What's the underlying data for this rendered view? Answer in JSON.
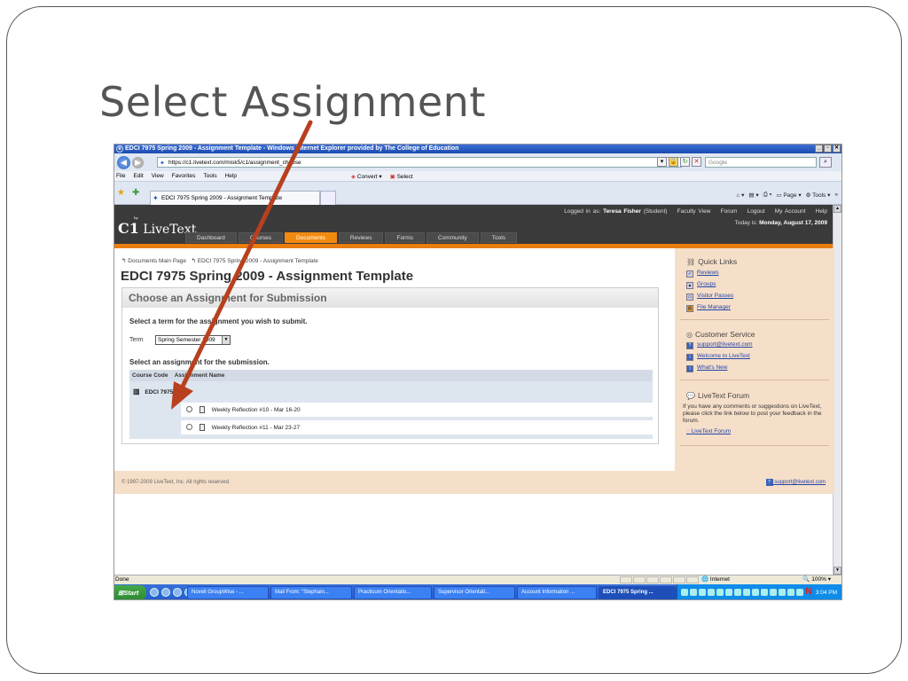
{
  "slide": {
    "title": "Select Assignment"
  },
  "browser": {
    "window_title": "EDCI 7975 Spring 2009 - Assignment Template - Windows Internet Explorer provided by The College of Education",
    "url": "https://c1.livetext.com/misk5/c1/assignment_choose",
    "search_placeholder": "Google",
    "menu": [
      "File",
      "Edit",
      "View",
      "Favorites",
      "Tools",
      "Help"
    ],
    "convert_label": "Convert",
    "select_label": "Select",
    "tab_title": "EDCI 7975 Spring 2009 - Assignment Template",
    "cmd_page": "Page",
    "cmd_tools": "Tools",
    "status_text": "Done",
    "zone": "Internet",
    "zoom": "100%"
  },
  "livetext": {
    "logo_by": "by",
    "logo_text": "LiveText",
    "logged_in_prefix": "Logged in as:",
    "user_name": "Teresa Fisher",
    "user_role": "(Student)",
    "top_links": [
      "Faculty View",
      "Forum",
      "Logout",
      "My Account",
      "Help"
    ],
    "date_prefix": "Today is:",
    "date_value": "Monday, August 17, 2009",
    "nav": [
      {
        "label": "Dashboard"
      },
      {
        "label": "Courses"
      },
      {
        "label": "Documents"
      },
      {
        "label": "Reviews"
      },
      {
        "label": "Forms"
      },
      {
        "label": "Community"
      },
      {
        "label": "Tools"
      }
    ],
    "breadcrumb": [
      "Documents Main Page",
      "EDCI 7975 Spring 2009 - Assignment Template"
    ],
    "page_title": "EDCI 7975 Spring 2009 - Assignment Template",
    "panel_title": "Choose an Assignment for Submission",
    "term_prompt": "Select a term for the assignment you wish to submit.",
    "term_label": "Term",
    "term_value": "Spring Semester 2009",
    "assign_prompt": "Select an assignment for the submission.",
    "col_course": "Course Code",
    "col_assignment": "Assignment Name",
    "course_code": "EDCI 7975",
    "assignments": [
      "Weekly Reflection #10 - Mar 16-20",
      "Weekly Reflection #11 - Mar 23-27"
    ],
    "copyright": "© 1997-2009 LiveText, Inc. All rights reserved.",
    "footer_support": "support@livetext.com"
  },
  "sidebar": {
    "quick_links_title": "Quick Links",
    "quick_links": [
      "Reviews",
      "Groups",
      "Visitor Passes",
      "File Manager"
    ],
    "customer_title": "Customer Service",
    "customer_links": [
      "support@livetext.com",
      "Welcome to LiveText",
      "What's New"
    ],
    "forum_title": "LiveText Forum",
    "forum_text": "If you have any comments or suggestions on LiveText, please click the link below to post your feedback in the forum.",
    "forum_link": "LiveText Forum"
  },
  "taskbar": {
    "start": "Start",
    "tasks": [
      "Novell GroupWise - ...",
      "Mail From: \"Stephain...",
      "Practicum Orientatio...",
      "Supervisor Orientati...",
      "Account Information ...",
      "EDCI 7975 Spring ..."
    ],
    "clock": "3:04 PM"
  },
  "colors": {
    "accent_orange": "#e87d10",
    "header_dark": "#3a3a3a",
    "sidebar_bg": "#f6dfc9",
    "arrow": "#b8401e"
  }
}
